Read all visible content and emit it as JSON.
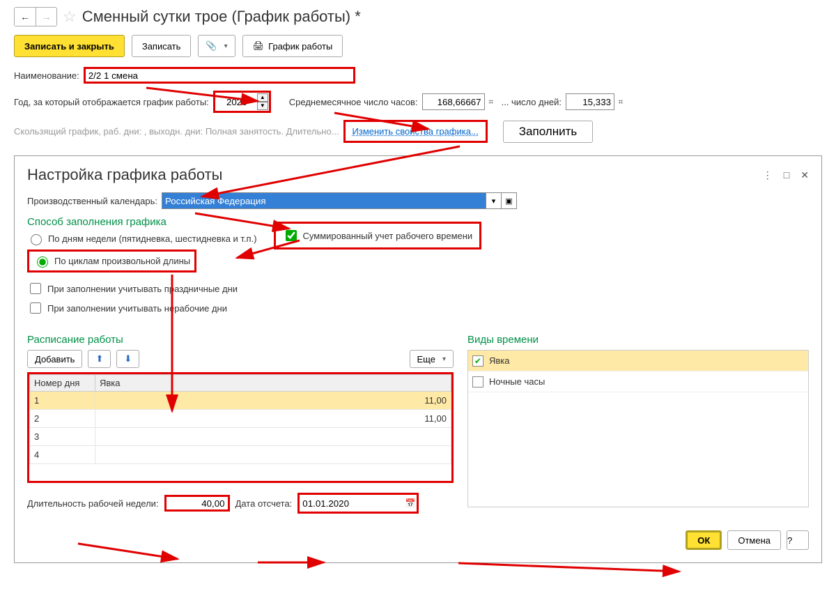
{
  "window": {
    "title": "Сменный сутки трое (График работы) *"
  },
  "toolbar": {
    "save_close": "Записать и закрыть",
    "save": "Записать",
    "print": "График работы"
  },
  "form": {
    "name_label": "Наименование:",
    "name_value": "2/2 1 смена",
    "year_label": "Год, за который отображается график работы:",
    "year_value": "2020",
    "avg_hours_label": "Среднемесячное число часов:",
    "avg_hours_value": "168,66667",
    "avg_days_label": "... число дней:",
    "avg_days_value": "15,333",
    "summary_text": "Скользящий график, раб. дни: , выходн. дни:  Полная занятость. Длительно...",
    "change_props_link": "Изменить свойства графика...",
    "fill_btn": "Заполнить"
  },
  "settings": {
    "title": "Настройка графика работы",
    "calendar_label": "Производственный календарь:",
    "calendar_value": "Российская Федерация",
    "method_heading": "Способ заполнения графика",
    "radio_weekdays": "По дням недели (пятидневка, шестидневка и т.п.)",
    "radio_cycles": "По циклам произвольной длины",
    "chk_summed": "Суммированный учет рабочего времени",
    "chk_holidays": "При заполнении учитывать праздничные дни",
    "chk_nonwork": "При заполнении учитывать нерабочие дни"
  },
  "schedule": {
    "heading": "Расписание работы",
    "add_btn": "Добавить",
    "more_btn": "Еще",
    "col_day": "Номер дня",
    "col_att": "Явка",
    "rows": [
      {
        "n": "1",
        "v": "11,00"
      },
      {
        "n": "2",
        "v": "11,00"
      },
      {
        "n": "3",
        "v": ""
      },
      {
        "n": "4",
        "v": ""
      }
    ],
    "week_len_label": "Длительность рабочей недели:",
    "week_len_value": "40,00",
    "start_date_label": "Дата отсчета:",
    "start_date_value": "01.01.2020"
  },
  "timetypes": {
    "heading": "Виды времени",
    "items": [
      {
        "checked": true,
        "label": "Явка"
      },
      {
        "checked": false,
        "label": "Ночные часы"
      }
    ]
  },
  "dialog": {
    "ok": "ОК",
    "cancel": "Отмена",
    "help": "?"
  }
}
